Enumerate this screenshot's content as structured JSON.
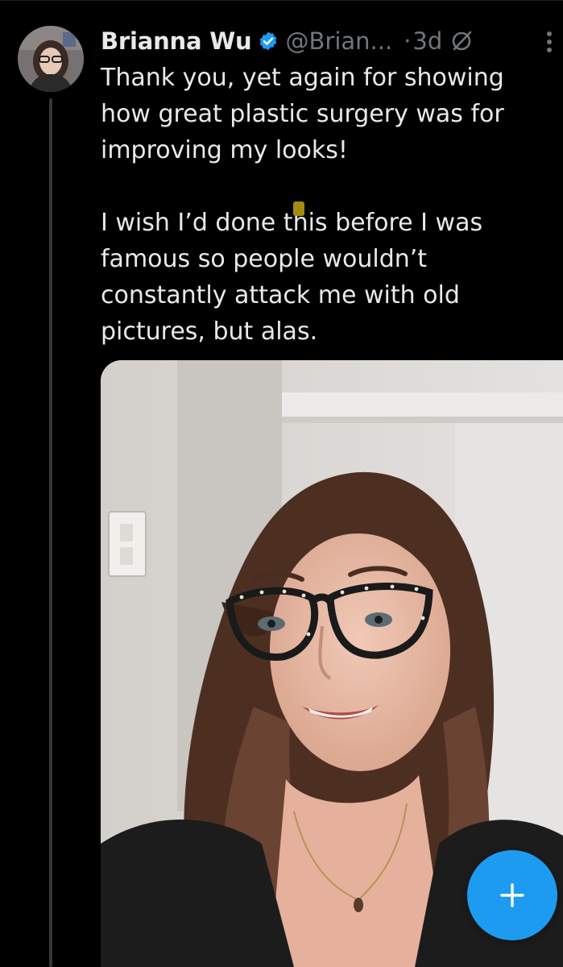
{
  "tweet": {
    "display_name": "Brianna Wu",
    "verified": true,
    "handle": "@Brian...",
    "separator": "·",
    "time": "3d",
    "paragraphs": [
      "Thank you, yet again for showing how great plastic surgery was for improving my looks!",
      "I wish I’d done this before I was famous so people wouldn’t constantly attack me with old pictures, but alas."
    ]
  },
  "icons": {
    "verified": "verified-badge-icon",
    "grok": "grok-icon",
    "more": "more-vertical-icon",
    "compose": "plus-icon"
  },
  "colors": {
    "background": "#000000",
    "text_primary": "#e7e9ea",
    "text_secondary": "#71767b",
    "accent": "#1d9bf0",
    "highlight": "#a58a10"
  }
}
